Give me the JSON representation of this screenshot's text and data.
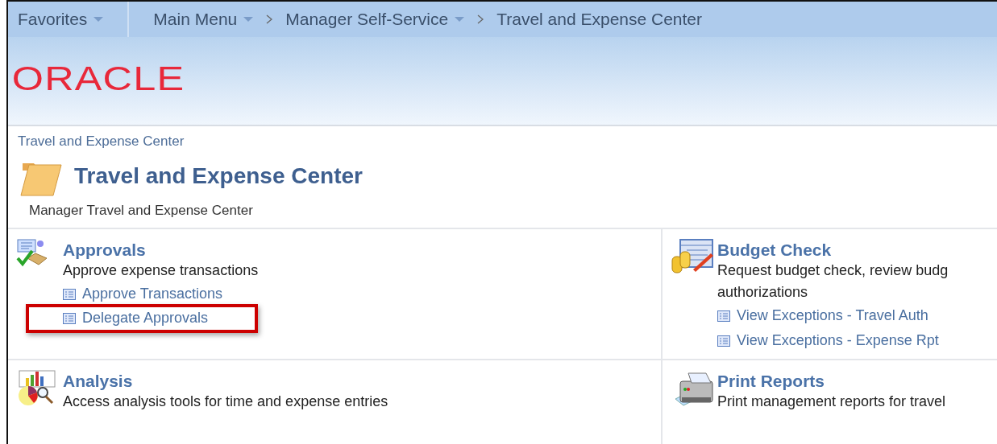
{
  "nav_bar": {
    "favorites": "Favorites",
    "items": [
      {
        "label": "Main Menu",
        "dropdown": true
      },
      {
        "label": "Manager Self-Service",
        "dropdown": true
      },
      {
        "label": "Travel and Expense Center",
        "dropdown": false
      }
    ]
  },
  "header": {
    "logo": "ORACLE"
  },
  "page": {
    "breadcrumb": "Travel and Expense Center",
    "title": "Travel and Expense Center",
    "description": "Manager Travel and Expense Center"
  },
  "sections": [
    {
      "kind": "approvals",
      "title": "Approvals",
      "description_lines": [
        "Approve expense transactions"
      ],
      "links": [
        {
          "label": "Approve Transactions",
          "highlighted": false
        },
        {
          "label": "Delegate Approvals",
          "highlighted": true
        }
      ]
    },
    {
      "kind": "budget",
      "title": "Budget Check",
      "description_lines": [
        "Request budget check, review budg",
        "authorizations"
      ],
      "links": [
        {
          "label": "View Exceptions - Travel Auth",
          "highlighted": false
        },
        {
          "label": "View Exceptions - Expense Rpt",
          "highlighted": false
        }
      ]
    },
    {
      "kind": "analysis",
      "title": "Analysis",
      "description_lines": [
        "Access analysis tools for time and expense entries"
      ]
    },
    {
      "kind": "print",
      "title": "Print Reports",
      "description_lines": [
        "Print management reports for travel"
      ]
    }
  ]
}
